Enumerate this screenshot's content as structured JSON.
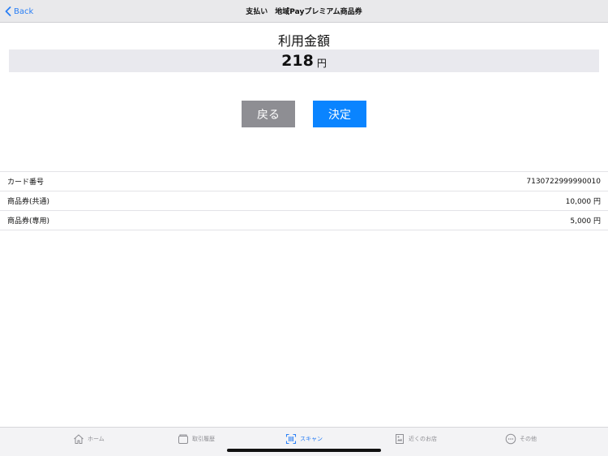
{
  "nav": {
    "back_label": "Back",
    "title": "支払い　地域Payプレミアム商品券"
  },
  "amount": {
    "label": "利用金額",
    "value": "218",
    "unit": "円"
  },
  "buttons": {
    "back_label": "戻る",
    "confirm_label": "決定"
  },
  "info_rows": [
    {
      "label": "カード番号",
      "value": "7130722999990010"
    },
    {
      "label": "商品券(共通)",
      "value": "10,000 円"
    },
    {
      "label": "商品券(専用)",
      "value": "5,000 円"
    }
  ],
  "tabbar": {
    "items": [
      {
        "label": "ホーム",
        "icon": "home-icon",
        "active": false
      },
      {
        "label": "取引履歴",
        "icon": "wallet-icon",
        "active": false
      },
      {
        "label": "スキャン",
        "icon": "scan-icon",
        "active": true
      },
      {
        "label": "近くのお店",
        "icon": "map-icon",
        "active": false
      },
      {
        "label": "その他",
        "icon": "more-icon",
        "active": false
      }
    ]
  },
  "colors": {
    "accent": "#0a84ff",
    "secondary_button": "#8e8e93",
    "tab_inactive": "#8e8e93"
  }
}
